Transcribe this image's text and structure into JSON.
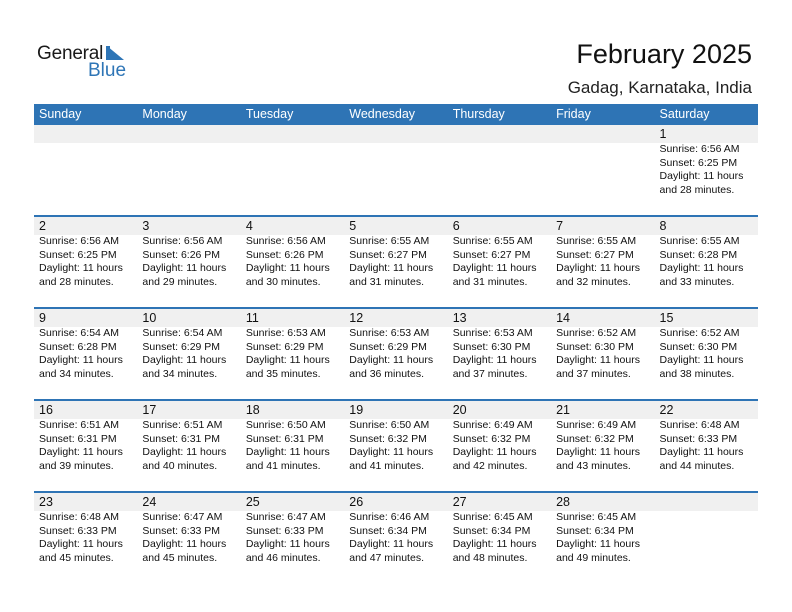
{
  "logo": {
    "word1": "General",
    "word2": "Blue",
    "icon": "triangle-flag-icon",
    "accent": "#2e75b6"
  },
  "header": {
    "title": "February 2025",
    "location": "Gadag, Karnataka, India"
  },
  "colors": {
    "header_bg": "#2e74b5",
    "row_bg": "#f0f0f0"
  },
  "weekdays": [
    "Sunday",
    "Monday",
    "Tuesday",
    "Wednesday",
    "Thursday",
    "Friday",
    "Saturday"
  ],
  "weeks": [
    [
      null,
      null,
      null,
      null,
      null,
      null,
      {
        "day": "1",
        "sunrise": "Sunrise: 6:56 AM",
        "sunset": "Sunset: 6:25 PM",
        "daylight1": "Daylight: 11 hours",
        "daylight2": "and 28 minutes."
      }
    ],
    [
      {
        "day": "2",
        "sunrise": "Sunrise: 6:56 AM",
        "sunset": "Sunset: 6:25 PM",
        "daylight1": "Daylight: 11 hours",
        "daylight2": "and 28 minutes."
      },
      {
        "day": "3",
        "sunrise": "Sunrise: 6:56 AM",
        "sunset": "Sunset: 6:26 PM",
        "daylight1": "Daylight: 11 hours",
        "daylight2": "and 29 minutes."
      },
      {
        "day": "4",
        "sunrise": "Sunrise: 6:56 AM",
        "sunset": "Sunset: 6:26 PM",
        "daylight1": "Daylight: 11 hours",
        "daylight2": "and 30 minutes."
      },
      {
        "day": "5",
        "sunrise": "Sunrise: 6:55 AM",
        "sunset": "Sunset: 6:27 PM",
        "daylight1": "Daylight: 11 hours",
        "daylight2": "and 31 minutes."
      },
      {
        "day": "6",
        "sunrise": "Sunrise: 6:55 AM",
        "sunset": "Sunset: 6:27 PM",
        "daylight1": "Daylight: 11 hours",
        "daylight2": "and 31 minutes."
      },
      {
        "day": "7",
        "sunrise": "Sunrise: 6:55 AM",
        "sunset": "Sunset: 6:27 PM",
        "daylight1": "Daylight: 11 hours",
        "daylight2": "and 32 minutes."
      },
      {
        "day": "8",
        "sunrise": "Sunrise: 6:55 AM",
        "sunset": "Sunset: 6:28 PM",
        "daylight1": "Daylight: 11 hours",
        "daylight2": "and 33 minutes."
      }
    ],
    [
      {
        "day": "9",
        "sunrise": "Sunrise: 6:54 AM",
        "sunset": "Sunset: 6:28 PM",
        "daylight1": "Daylight: 11 hours",
        "daylight2": "and 34 minutes."
      },
      {
        "day": "10",
        "sunrise": "Sunrise: 6:54 AM",
        "sunset": "Sunset: 6:29 PM",
        "daylight1": "Daylight: 11 hours",
        "daylight2": "and 34 minutes."
      },
      {
        "day": "11",
        "sunrise": "Sunrise: 6:53 AM",
        "sunset": "Sunset: 6:29 PM",
        "daylight1": "Daylight: 11 hours",
        "daylight2": "and 35 minutes."
      },
      {
        "day": "12",
        "sunrise": "Sunrise: 6:53 AM",
        "sunset": "Sunset: 6:29 PM",
        "daylight1": "Daylight: 11 hours",
        "daylight2": "and 36 minutes."
      },
      {
        "day": "13",
        "sunrise": "Sunrise: 6:53 AM",
        "sunset": "Sunset: 6:30 PM",
        "daylight1": "Daylight: 11 hours",
        "daylight2": "and 37 minutes."
      },
      {
        "day": "14",
        "sunrise": "Sunrise: 6:52 AM",
        "sunset": "Sunset: 6:30 PM",
        "daylight1": "Daylight: 11 hours",
        "daylight2": "and 37 minutes."
      },
      {
        "day": "15",
        "sunrise": "Sunrise: 6:52 AM",
        "sunset": "Sunset: 6:30 PM",
        "daylight1": "Daylight: 11 hours",
        "daylight2": "and 38 minutes."
      }
    ],
    [
      {
        "day": "16",
        "sunrise": "Sunrise: 6:51 AM",
        "sunset": "Sunset: 6:31 PM",
        "daylight1": "Daylight: 11 hours",
        "daylight2": "and 39 minutes."
      },
      {
        "day": "17",
        "sunrise": "Sunrise: 6:51 AM",
        "sunset": "Sunset: 6:31 PM",
        "daylight1": "Daylight: 11 hours",
        "daylight2": "and 40 minutes."
      },
      {
        "day": "18",
        "sunrise": "Sunrise: 6:50 AM",
        "sunset": "Sunset: 6:31 PM",
        "daylight1": "Daylight: 11 hours",
        "daylight2": "and 41 minutes."
      },
      {
        "day": "19",
        "sunrise": "Sunrise: 6:50 AM",
        "sunset": "Sunset: 6:32 PM",
        "daylight1": "Daylight: 11 hours",
        "daylight2": "and 41 minutes."
      },
      {
        "day": "20",
        "sunrise": "Sunrise: 6:49 AM",
        "sunset": "Sunset: 6:32 PM",
        "daylight1": "Daylight: 11 hours",
        "daylight2": "and 42 minutes."
      },
      {
        "day": "21",
        "sunrise": "Sunrise: 6:49 AM",
        "sunset": "Sunset: 6:32 PM",
        "daylight1": "Daylight: 11 hours",
        "daylight2": "and 43 minutes."
      },
      {
        "day": "22",
        "sunrise": "Sunrise: 6:48 AM",
        "sunset": "Sunset: 6:33 PM",
        "daylight1": "Daylight: 11 hours",
        "daylight2": "and 44 minutes."
      }
    ],
    [
      {
        "day": "23",
        "sunrise": "Sunrise: 6:48 AM",
        "sunset": "Sunset: 6:33 PM",
        "daylight1": "Daylight: 11 hours",
        "daylight2": "and 45 minutes."
      },
      {
        "day": "24",
        "sunrise": "Sunrise: 6:47 AM",
        "sunset": "Sunset: 6:33 PM",
        "daylight1": "Daylight: 11 hours",
        "daylight2": "and 45 minutes."
      },
      {
        "day": "25",
        "sunrise": "Sunrise: 6:47 AM",
        "sunset": "Sunset: 6:33 PM",
        "daylight1": "Daylight: 11 hours",
        "daylight2": "and 46 minutes."
      },
      {
        "day": "26",
        "sunrise": "Sunrise: 6:46 AM",
        "sunset": "Sunset: 6:34 PM",
        "daylight1": "Daylight: 11 hours",
        "daylight2": "and 47 minutes."
      },
      {
        "day": "27",
        "sunrise": "Sunrise: 6:45 AM",
        "sunset": "Sunset: 6:34 PM",
        "daylight1": "Daylight: 11 hours",
        "daylight2": "and 48 minutes."
      },
      {
        "day": "28",
        "sunrise": "Sunrise: 6:45 AM",
        "sunset": "Sunset: 6:34 PM",
        "daylight1": "Daylight: 11 hours",
        "daylight2": "and 49 minutes."
      },
      null
    ]
  ]
}
